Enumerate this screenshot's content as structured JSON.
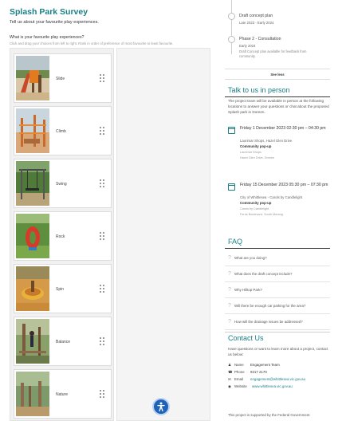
{
  "survey": {
    "title": "Splash Park Survey",
    "subtitle": "Tell us about your favourite play experiences.",
    "question": "What is your favourite play experiences?",
    "instruction": "Click and drag your choices from left to right. Rank in order of preference of most favourite to least favourite.",
    "items": [
      {
        "label": "Slide",
        "icon": "slide-playground-photo"
      },
      {
        "label": "Climb",
        "icon": "climbing-frame-photo"
      },
      {
        "label": "Swing",
        "icon": "swing-set-photo"
      },
      {
        "label": "Rock",
        "icon": "rocker-toy-photo"
      },
      {
        "label": "Spin",
        "icon": "spinner-photo"
      },
      {
        "label": "Balance",
        "icon": "balance-beam-photo"
      },
      {
        "label": "Nature",
        "icon": "nature-play-photo"
      }
    ]
  },
  "timeline": {
    "stage1": {
      "title": "Draft concept plan",
      "date": "Late 2023 - Early 2024"
    },
    "stage2": {
      "title": "Phase 2 - Consultation",
      "date": "Early 2024",
      "note": "Draft Concept plan available for feedback from community."
    },
    "see_less": "See less"
  },
  "talk": {
    "title": "Talk to us in person",
    "intro": "The project team will be available in person at the following locations to answer your questions or chat about the proposed Splash park in Doreen.",
    "events": [
      {
        "when": "Friday 1 December 2023 02:30 pm – 04:30 pm",
        "address": "Laurimar Shops, Hazel Glen Drive",
        "tag": "Community pop-up",
        "place": "Laurimar Shops",
        "place_address": "Hazel Glen Drive, Doreen"
      },
      {
        "when": "Friday 15 December 2023 05:30 pm – 07:30 pm",
        "address": "City of Whittlesea - Carols by Candlelight",
        "tag": "Community pop-up",
        "place": "Carols by Candlelight",
        "place_address": "Ferris Boulevard, South Morang"
      }
    ]
  },
  "faq": {
    "title": "FAQ",
    "items": [
      "What are you doing?",
      "What does the draft concept include?",
      "Why Hilltop Park?",
      "Will there be enough car parking for the area?",
      "How will the drainage issues be addressed?"
    ]
  },
  "contact": {
    "title": "Contact Us",
    "intro": "Have questions or want to learn more about a project, contact us below:",
    "name_label": "Name",
    "name_value": "Engagement Team",
    "phone_label": "Phone",
    "phone_value": "9217 2170",
    "email_label": "Email",
    "email_value": "engagement@whittlesea.vic.gov.au",
    "website_label": "Website",
    "website_value": "www.whittlesea.vic.gov.au"
  },
  "footer": {
    "text": "This project is supported by the Federal Government"
  },
  "colors": {
    "accent": "#1a7f86",
    "a11y": "#1e63b8"
  }
}
